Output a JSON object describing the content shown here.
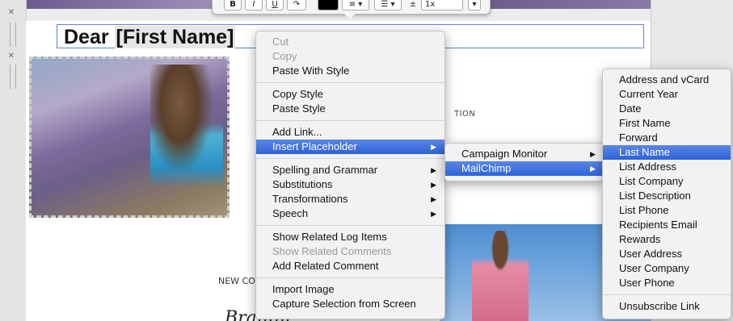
{
  "editor": {
    "greeting": "Dear ",
    "placeholder": "[First Name]",
    "collection_text": "TION",
    "new_collection_text": "NEW CO",
    "brand_text": "Branini"
  },
  "toolbar": {
    "bold": "B",
    "italic": "I",
    "underline": "U",
    "line_spacing": "1x"
  },
  "context_menu": {
    "cut": "Cut",
    "copy": "Copy",
    "paste_with_style": "Paste With Style",
    "copy_style": "Copy Style",
    "paste_style": "Paste Style",
    "add_link": "Add Link...",
    "insert_placeholder": "Insert Placeholder",
    "spelling_grammar": "Spelling and Grammar",
    "substitutions": "Substitutions",
    "transformations": "Transformations",
    "speech": "Speech",
    "show_related_log_items": "Show Related Log Items",
    "show_related_comments": "Show Related Comments",
    "add_related_comment": "Add Related Comment",
    "import_image": "Import Image",
    "capture_selection": "Capture Selection from Screen"
  },
  "placeholder_menu": {
    "campaign_monitor": "Campaign Monitor",
    "mailchimp": "MailChimp"
  },
  "mailchimp_menu": {
    "items": [
      "Address and vCard",
      "Current Year",
      "Date",
      "First Name",
      "Forward",
      "Last Name",
      "List Address",
      "List Company",
      "List Description",
      "List Phone",
      "Recipients Email",
      "Rewards",
      "User Address",
      "User Company",
      "User Phone"
    ],
    "unsubscribe": "Unsubscribe Link"
  },
  "colors": {
    "selection": "#2d63d8",
    "field_border": "#5f86c8"
  }
}
